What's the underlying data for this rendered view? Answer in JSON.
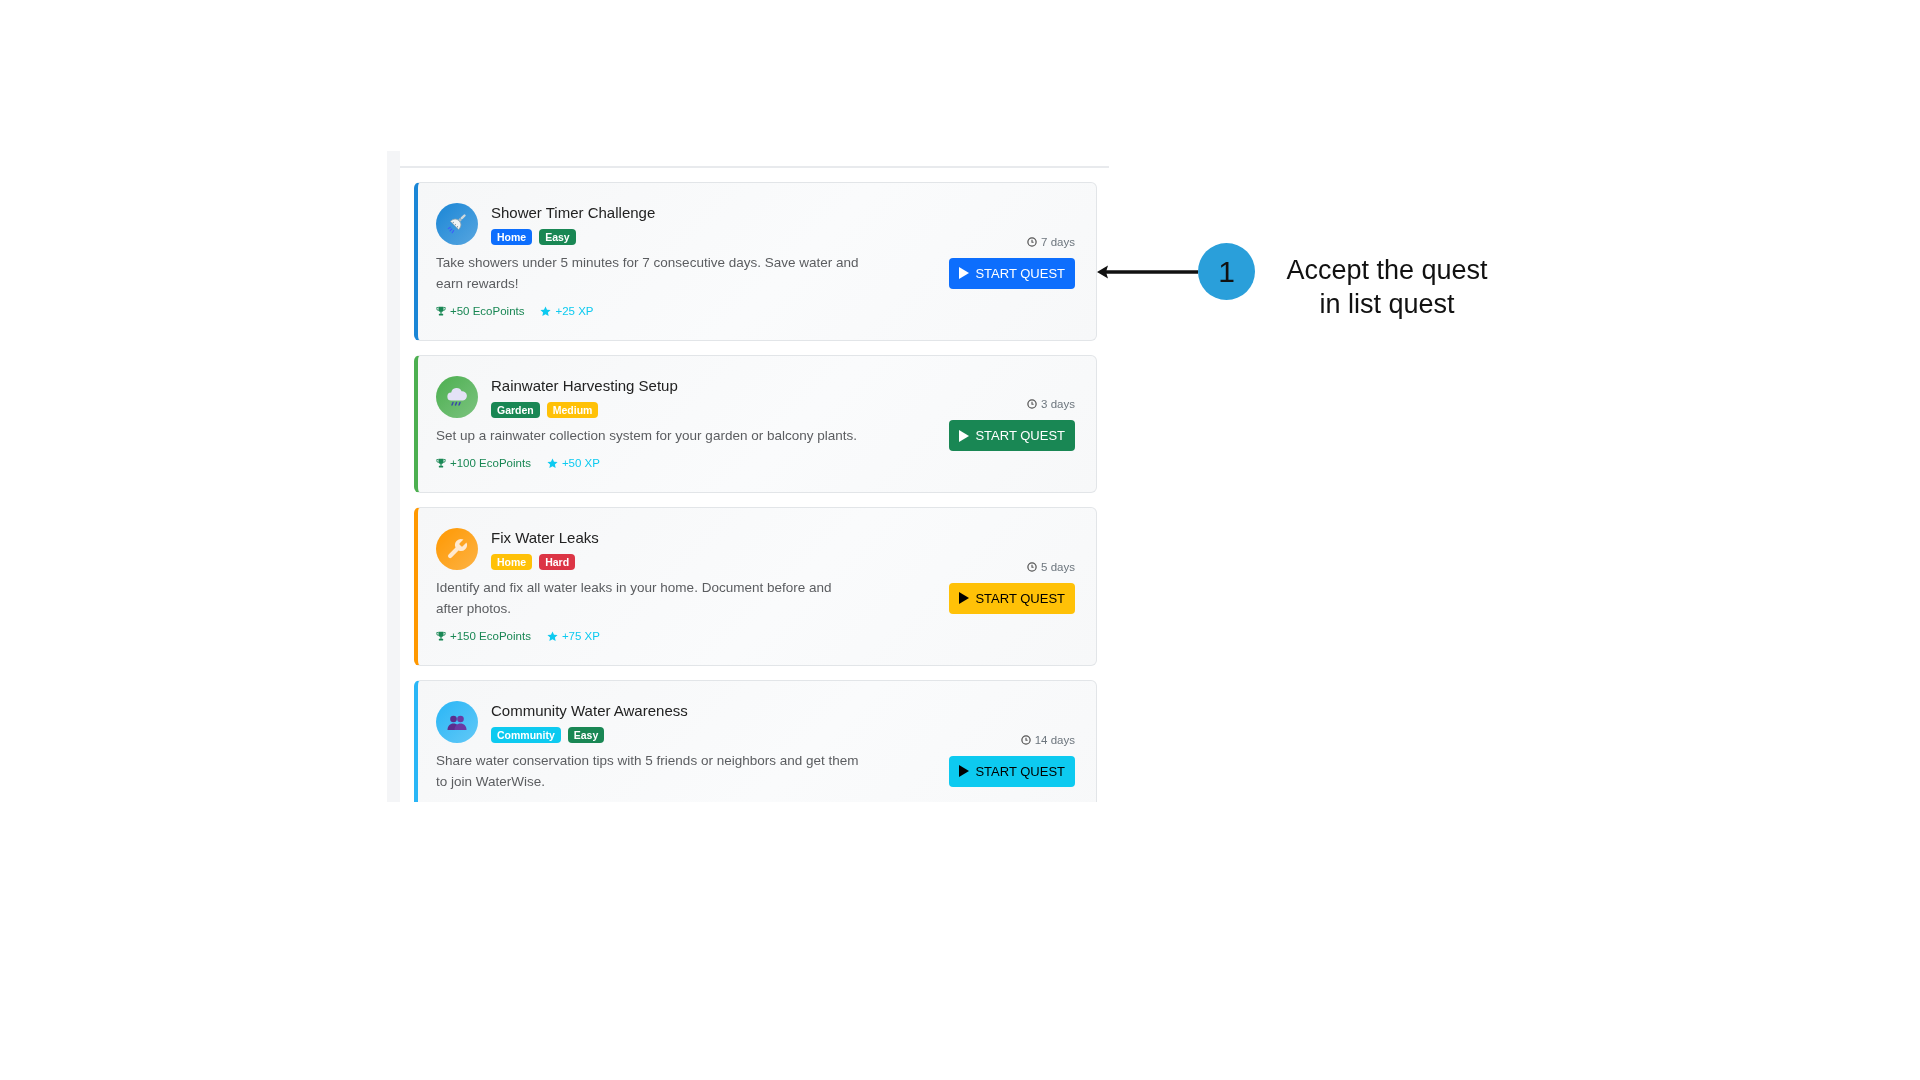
{
  "panel": {
    "quests": [
      {
        "title": "Shower Timer Challenge",
        "color": "#1a86d6",
        "badges": [
          {
            "label": "Home",
            "color": "#0d6efd"
          },
          {
            "label": "Easy",
            "color": "#198754"
          }
        ],
        "description": "Take showers under 5 minutes for 7 consecutive days. Save water and earn rewards!",
        "rewards": [
          {
            "kind": "points",
            "text": "+50 EcoPoints"
          },
          {
            "kind": "xp",
            "text": "+25 XP"
          }
        ],
        "duration": "7 days",
        "button": {
          "label": "START QUEST",
          "color": "#0d6efd"
        }
      },
      {
        "title": "Rainwater Harvesting Setup",
        "color": "#4caf50",
        "badges": [
          {
            "label": "Garden",
            "color": "#198754"
          },
          {
            "label": "Medium",
            "color": "#ffc107"
          }
        ],
        "description": "Set up a rainwater collection system for your garden or balcony plants.",
        "rewards": [
          {
            "kind": "points",
            "text": "+100 EcoPoints"
          },
          {
            "kind": "xp",
            "text": "+50 XP"
          }
        ],
        "duration": "3 days",
        "button": {
          "label": "START QUEST",
          "color": "#198754"
        }
      },
      {
        "title": "Fix Water Leaks",
        "color": "#ff9800",
        "badges": [
          {
            "label": "Home",
            "color": "#ffc107"
          },
          {
            "label": "Hard",
            "color": "#dc3545"
          }
        ],
        "description": "Identify and fix all water leaks in your home. Document before and after photos.",
        "rewards": [
          {
            "kind": "points",
            "text": "+150 EcoPoints"
          },
          {
            "kind": "xp",
            "text": "+75 XP"
          }
        ],
        "duration": "5 days",
        "button": {
          "label": "START QUEST",
          "color": "#ffc107"
        }
      },
      {
        "title": "Community Water Awareness",
        "color": "#29b6f6",
        "badges": [
          {
            "label": "Community",
            "color": "#0dcaf0"
          },
          {
            "label": "Easy",
            "color": "#198754"
          }
        ],
        "description": "Share water conservation tips with 5 friends or neighbors and get them to join WaterWise.",
        "duration": "14 days",
        "button": {
          "label": "START QUEST",
          "color": "#0dcaf0"
        }
      }
    ]
  },
  "annotation": {
    "step": "1",
    "text": "Accept the quest in list quest"
  }
}
